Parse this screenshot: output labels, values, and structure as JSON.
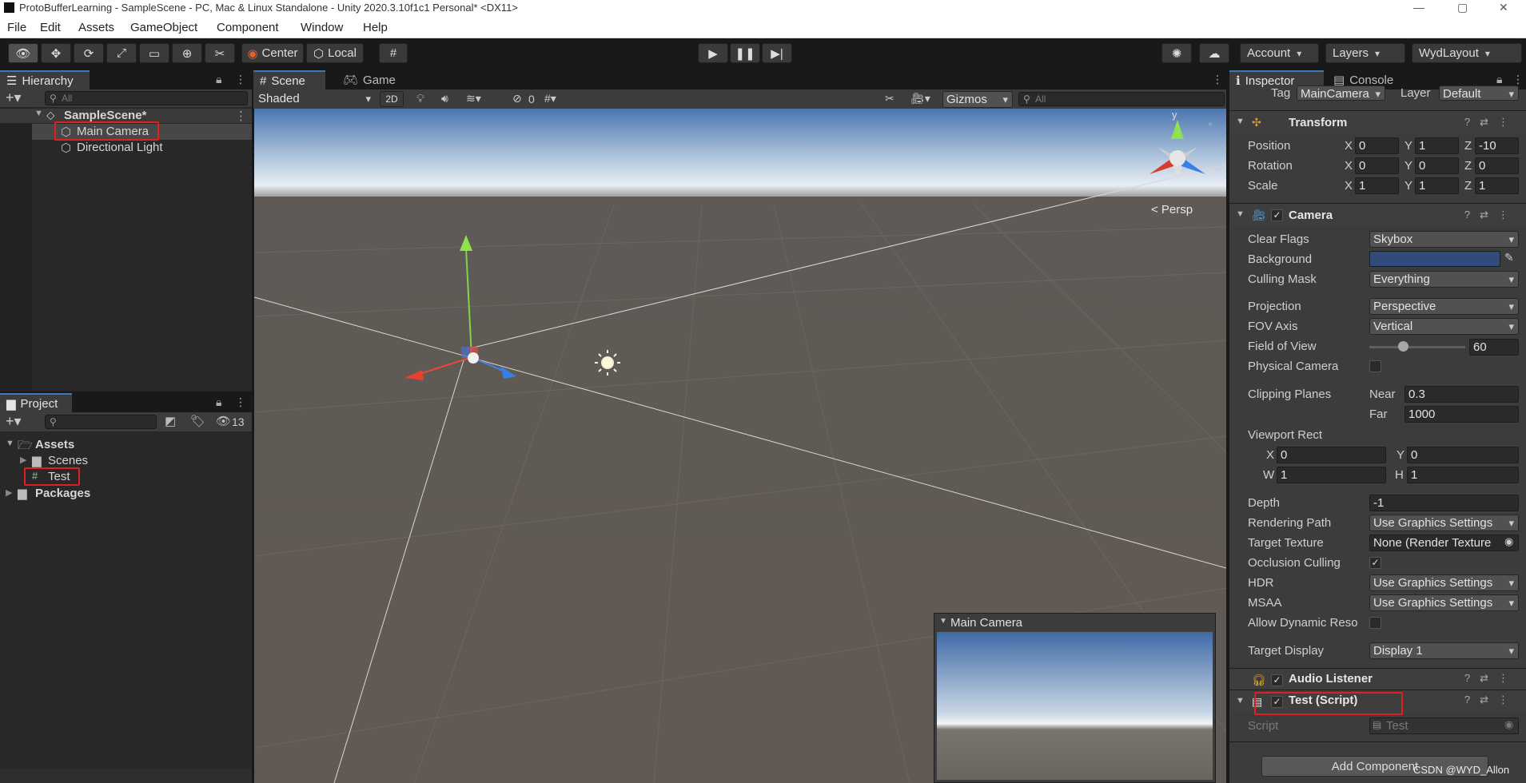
{
  "window": {
    "title": "ProtoBufferLearning - SampleScene - PC, Mac & Linux Standalone - Unity 2020.3.10f1c1 Personal* <DX11>",
    "controls": [
      "—",
      "▢",
      "✕"
    ]
  },
  "menu": [
    "File",
    "Edit",
    "Assets",
    "GameObject",
    "Component",
    "Window",
    "Help"
  ],
  "toolbar": {
    "pivot_label": "Center",
    "space_label": "Local",
    "account_label": "Account",
    "layers_label": "Layers",
    "layout_label": "WydLayout"
  },
  "hierarchy": {
    "tab_label": "Hierarchy",
    "search_placeholder": "All",
    "scene_name": "SampleScene*",
    "items": [
      "Main Camera",
      "Directional Light"
    ]
  },
  "project": {
    "tab_label": "Project",
    "hidden_count": "13",
    "root": "Assets",
    "children": [
      "Scenes",
      "Test"
    ],
    "packages": "Packages"
  },
  "scene_view": {
    "tabs": [
      "Scene",
      "Game"
    ],
    "shading_mode": "Shaded",
    "mode_2d": "2D",
    "hidden_count": "0",
    "gizmos_label": "Gizmos",
    "search_placeholder": "All",
    "persp_label": "< Persp",
    "gizmo_axes": {
      "x": "x",
      "y": "y",
      "z": "z"
    },
    "camera_preview_title": "Main Camera"
  },
  "inspector": {
    "tabs": [
      "Inspector",
      "Console"
    ],
    "tag_label": "Tag",
    "tag_value": "MainCamera",
    "layer_label": "Layer",
    "layer_value": "Default",
    "transform": {
      "title": "Transform",
      "position": {
        "label": "Position",
        "x": "0",
        "y": "1",
        "z": "-10"
      },
      "rotation": {
        "label": "Rotation",
        "x": "0",
        "y": "0",
        "z": "0"
      },
      "scale": {
        "label": "Scale",
        "x": "1",
        "y": "1",
        "z": "1"
      }
    },
    "camera": {
      "title": "Camera",
      "clear_flags": {
        "label": "Clear Flags",
        "value": "Skybox"
      },
      "background": {
        "label": "Background",
        "color": "#2f4c7a"
      },
      "culling_mask": {
        "label": "Culling Mask",
        "value": "Everything"
      },
      "projection": {
        "label": "Projection",
        "value": "Perspective"
      },
      "fov_axis": {
        "label": "FOV Axis",
        "value": "Vertical"
      },
      "field_of_view": {
        "label": "Field of View",
        "value": "60",
        "slider_fraction": 0.35
      },
      "physical_camera": {
        "label": "Physical Camera",
        "checked": false
      },
      "clipping_planes": {
        "label": "Clipping Planes",
        "near_label": "Near",
        "near": "0.3",
        "far_label": "Far",
        "far": "1000"
      },
      "viewport_rect": {
        "label": "Viewport Rect",
        "x": "0",
        "y": "0",
        "w": "1",
        "h": "1"
      },
      "depth": {
        "label": "Depth",
        "value": "-1"
      },
      "rendering_path": {
        "label": "Rendering Path",
        "value": "Use Graphics Settings"
      },
      "target_texture": {
        "label": "Target Texture",
        "value": "None (Render Texture"
      },
      "occlusion_culling": {
        "label": "Occlusion Culling",
        "checked": true
      },
      "hdr": {
        "label": "HDR",
        "value": "Use Graphics Settings"
      },
      "msaa": {
        "label": "MSAA",
        "value": "Use Graphics Settings"
      },
      "allow_dynamic": {
        "label": "Allow Dynamic Reso",
        "checked": false
      },
      "target_display": {
        "label": "Target Display",
        "value": "Display 1"
      }
    },
    "audio_listener": {
      "title": "Audio Listener"
    },
    "test_script": {
      "title": "Test (Script)",
      "script_label": "Script",
      "script_value": "Test"
    },
    "add_component": "Add Component"
  },
  "watermark": "CSDN @WYD_Allon",
  "colors": {
    "highlight": "#e02020",
    "accent": "#3a79bb",
    "selection": "#46607c"
  }
}
